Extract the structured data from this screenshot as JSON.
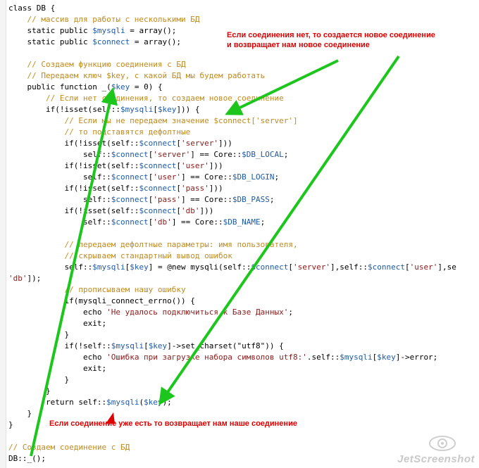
{
  "code_lines": [
    {
      "parts": [
        {
          "t": "class DB {",
          "c": "k"
        }
      ]
    },
    {
      "parts": [
        {
          "t": "    // массив для работы с несколькими БД",
          "c": "c"
        }
      ]
    },
    {
      "parts": [
        {
          "t": "    static public ",
          "c": "k"
        },
        {
          "t": "$mysqli",
          "c": "v"
        },
        {
          "t": " = array();",
          "c": "k"
        }
      ]
    },
    {
      "parts": [
        {
          "t": "    static public ",
          "c": "k"
        },
        {
          "t": "$connect",
          "c": "v"
        },
        {
          "t": " = array();",
          "c": "k"
        }
      ]
    },
    {
      "parts": [
        {
          "t": "",
          "c": "k"
        }
      ]
    },
    {
      "parts": [
        {
          "t": "    // Создаем функцию соединения с БД",
          "c": "c"
        }
      ]
    },
    {
      "parts": [
        {
          "t": "    // Передаем ключ $key, с какой БД мы будем работать",
          "c": "c"
        }
      ]
    },
    {
      "parts": [
        {
          "t": "    public function _(",
          "c": "k"
        },
        {
          "t": "$key",
          "c": "v"
        },
        {
          "t": " = 0) {",
          "c": "k"
        }
      ]
    },
    {
      "parts": [
        {
          "t": "        // Если нет соединения, то создаем новое соединение",
          "c": "c"
        }
      ]
    },
    {
      "parts": [
        {
          "t": "        if(!isset(self::",
          "c": "k"
        },
        {
          "t": "$mysqli",
          "c": "v"
        },
        {
          "t": "[",
          "c": "k"
        },
        {
          "t": "$key",
          "c": "v"
        },
        {
          "t": "])) {",
          "c": "k"
        }
      ]
    },
    {
      "parts": [
        {
          "t": "            // Если мы не передаем значение $connect['server']",
          "c": "c"
        }
      ]
    },
    {
      "parts": [
        {
          "t": "            // то подставятся дефолтные",
          "c": "c"
        }
      ]
    },
    {
      "parts": [
        {
          "t": "            if(!isset(self::",
          "c": "k"
        },
        {
          "t": "$connect",
          "c": "v"
        },
        {
          "t": "[",
          "c": "k"
        },
        {
          "t": "'server'",
          "c": "s"
        },
        {
          "t": "]))",
          "c": "k"
        }
      ]
    },
    {
      "parts": [
        {
          "t": "                self::",
          "c": "k"
        },
        {
          "t": "$connect",
          "c": "v"
        },
        {
          "t": "[",
          "c": "k"
        },
        {
          "t": "'server'",
          "c": "s"
        },
        {
          "t": "] == Core::",
          "c": "k"
        },
        {
          "t": "$DB_LOCAL",
          "c": "v"
        },
        {
          "t": ";",
          "c": "k"
        }
      ]
    },
    {
      "parts": [
        {
          "t": "            if(!isset(self::",
          "c": "k"
        },
        {
          "t": "$connect",
          "c": "v"
        },
        {
          "t": "[",
          "c": "k"
        },
        {
          "t": "'user'",
          "c": "s"
        },
        {
          "t": "]))",
          "c": "k"
        }
      ]
    },
    {
      "parts": [
        {
          "t": "                self::",
          "c": "k"
        },
        {
          "t": "$connect",
          "c": "v"
        },
        {
          "t": "[",
          "c": "k"
        },
        {
          "t": "'user'",
          "c": "s"
        },
        {
          "t": "] == Core::",
          "c": "k"
        },
        {
          "t": "$DB_LOGIN",
          "c": "v"
        },
        {
          "t": ";",
          "c": "k"
        }
      ]
    },
    {
      "parts": [
        {
          "t": "            if(!isset(self::",
          "c": "k"
        },
        {
          "t": "$connect",
          "c": "v"
        },
        {
          "t": "[",
          "c": "k"
        },
        {
          "t": "'pass'",
          "c": "s"
        },
        {
          "t": "]))",
          "c": "k"
        }
      ]
    },
    {
      "parts": [
        {
          "t": "                self::",
          "c": "k"
        },
        {
          "t": "$connect",
          "c": "v"
        },
        {
          "t": "[",
          "c": "k"
        },
        {
          "t": "'pass'",
          "c": "s"
        },
        {
          "t": "] == Core::",
          "c": "k"
        },
        {
          "t": "$DB_PASS",
          "c": "v"
        },
        {
          "t": ";",
          "c": "k"
        }
      ]
    },
    {
      "parts": [
        {
          "t": "            if(!isset(self::",
          "c": "k"
        },
        {
          "t": "$connect",
          "c": "v"
        },
        {
          "t": "[",
          "c": "k"
        },
        {
          "t": "'db'",
          "c": "s"
        },
        {
          "t": "]))",
          "c": "k"
        }
      ]
    },
    {
      "parts": [
        {
          "t": "                self::",
          "c": "k"
        },
        {
          "t": "$connect",
          "c": "v"
        },
        {
          "t": "[",
          "c": "k"
        },
        {
          "t": "'db'",
          "c": "s"
        },
        {
          "t": "] == Core::",
          "c": "k"
        },
        {
          "t": "$DB_NAME",
          "c": "v"
        },
        {
          "t": ";",
          "c": "k"
        }
      ]
    },
    {
      "parts": [
        {
          "t": "",
          "c": "k"
        }
      ]
    },
    {
      "parts": [
        {
          "t": "            // передаем дефолтные параметры: имя пользователя,",
          "c": "c"
        }
      ]
    },
    {
      "parts": [
        {
          "t": "            // скрываем стандартный вывод ошибок",
          "c": "c"
        }
      ]
    },
    {
      "parts": [
        {
          "t": "            self::",
          "c": "k"
        },
        {
          "t": "$mysqli",
          "c": "v"
        },
        {
          "t": "[",
          "c": "k"
        },
        {
          "t": "$key",
          "c": "v"
        },
        {
          "t": "] = @new mysqli(self::",
          "c": "k"
        },
        {
          "t": "$connect",
          "c": "v"
        },
        {
          "t": "[",
          "c": "k"
        },
        {
          "t": "'server'",
          "c": "s"
        },
        {
          "t": "],self::",
          "c": "k"
        },
        {
          "t": "$connect",
          "c": "v"
        },
        {
          "t": "[",
          "c": "k"
        },
        {
          "t": "'user'",
          "c": "s"
        },
        {
          "t": "],se",
          "c": "k"
        }
      ]
    },
    {
      "parts": [
        {
          "t": "'db'",
          "c": "s"
        },
        {
          "t": "]);",
          "c": "k"
        }
      ]
    },
    {
      "parts": [
        {
          "t": "            // прописываем нашу ошибку",
          "c": "c"
        }
      ]
    },
    {
      "parts": [
        {
          "t": "            if(mysqli_connect_errno()) {",
          "c": "k"
        }
      ]
    },
    {
      "parts": [
        {
          "t": "                echo ",
          "c": "k"
        },
        {
          "t": "'Не удалось подключиться к Базе Данных'",
          "c": "s"
        },
        {
          "t": ";",
          "c": "k"
        }
      ]
    },
    {
      "parts": [
        {
          "t": "                exit;",
          "c": "k"
        }
      ]
    },
    {
      "parts": [
        {
          "t": "            }",
          "c": "k"
        }
      ]
    },
    {
      "parts": [
        {
          "t": "            if(!self::",
          "c": "k"
        },
        {
          "t": "$mysqli",
          "c": "v"
        },
        {
          "t": "[",
          "c": "k"
        },
        {
          "t": "$key",
          "c": "v"
        },
        {
          "t": "]->set_charset(\"utf8\")) {",
          "c": "k"
        }
      ]
    },
    {
      "parts": [
        {
          "t": "                echo ",
          "c": "k"
        },
        {
          "t": "'Ошибка при загрузке набора символов utf8:'",
          "c": "s"
        },
        {
          "t": ".self::",
          "c": "k"
        },
        {
          "t": "$mysqli",
          "c": "v"
        },
        {
          "t": "[",
          "c": "k"
        },
        {
          "t": "$key",
          "c": "v"
        },
        {
          "t": "]->error;",
          "c": "k"
        }
      ]
    },
    {
      "parts": [
        {
          "t": "                exit;",
          "c": "k"
        }
      ]
    },
    {
      "parts": [
        {
          "t": "            }",
          "c": "k"
        }
      ]
    },
    {
      "parts": [
        {
          "t": "        }",
          "c": "k"
        }
      ]
    },
    {
      "parts": [
        {
          "t": "        return self::",
          "c": "k"
        },
        {
          "t": "$mysqli",
          "c": "v"
        },
        {
          "t": "(",
          "c": "k"
        },
        {
          "t": "$key",
          "c": "v"
        },
        {
          "t": ");",
          "c": "k"
        }
      ]
    },
    {
      "parts": [
        {
          "t": "    }",
          "c": "k"
        }
      ]
    },
    {
      "parts": [
        {
          "t": "}",
          "c": "k"
        }
      ]
    },
    {
      "parts": [
        {
          "t": "",
          "c": "k"
        }
      ]
    },
    {
      "parts": [
        {
          "t": "// Создаем соединение с БД",
          "c": "c"
        }
      ]
    },
    {
      "parts": [
        {
          "t": "DB::_();",
          "c": "k"
        }
      ]
    }
  ],
  "annotations": {
    "note_top_line1": "Если соединения нет, то создается новое соединение",
    "note_top_line2": "и возвращает нам новое соединение",
    "note_bottom": "Если соединение уже есть то возвращает нам наше соединение"
  },
  "colors": {
    "comment": "#c08a1c",
    "variable": "#1e5aa8",
    "string": "#8b1a1a",
    "annotation_text": "#e00000",
    "arrow_green": "#1cc61c",
    "arrow_red": "#e00000"
  },
  "watermark": {
    "text": "JetScreenshot",
    "icon": "eye-swirl-icon"
  }
}
